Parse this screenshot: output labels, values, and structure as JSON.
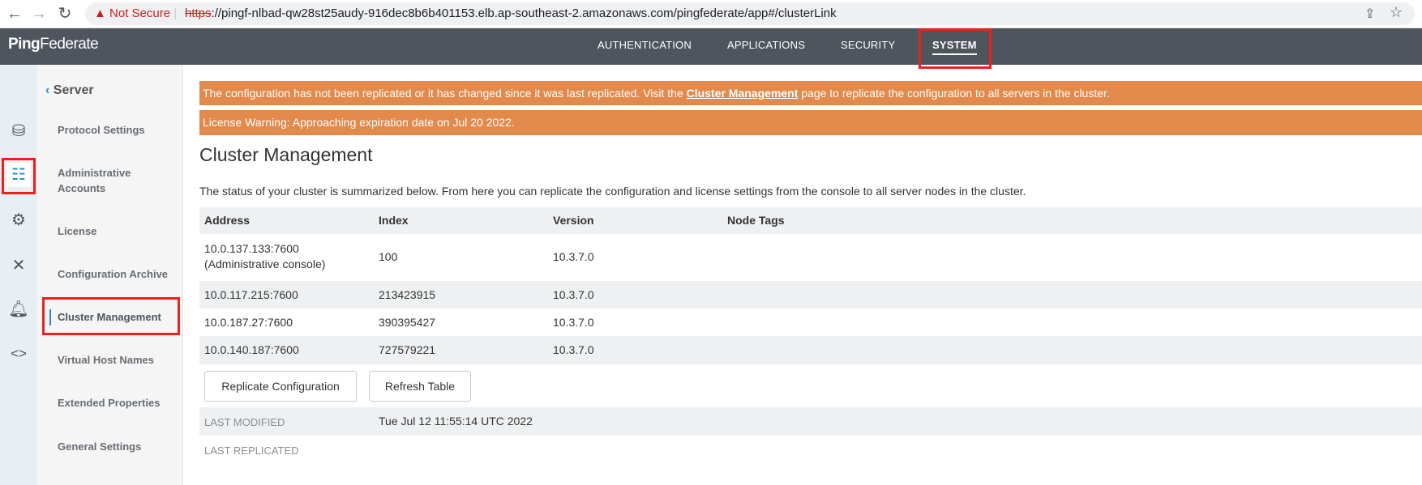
{
  "browser": {
    "not_secure": "Not Secure",
    "url_scheme": "https",
    "url_rest": "://pingf-nlbad-qw28st25audy-916dec8b6b401153.elb.ap-southeast-2.amazonaws.com/pingfederate/app#/clusterLink"
  },
  "header": {
    "logo_bold": "Ping",
    "logo_rest": "Federate",
    "tabs": [
      "AUTHENTICATION",
      "APPLICATIONS",
      "SECURITY",
      "SYSTEM"
    ],
    "active_tab": "SYSTEM"
  },
  "sidebar": {
    "back_label": "Server",
    "items": [
      "Protocol Settings",
      "Administrative Accounts",
      "License",
      "Configuration Archive",
      "Cluster Management",
      "Virtual Host Names",
      "Extended Properties",
      "General Settings"
    ],
    "active": "Cluster Management"
  },
  "banners": {
    "replication_pre": "The configuration has not been replicated or it has changed since it was last replicated. Visit the ",
    "replication_link": "Cluster Management",
    "replication_post": " page to replicate the configuration to all servers in the cluster.",
    "license": "License Warning: Approaching expiration date on Jul 20 2022."
  },
  "main": {
    "title": "Cluster Management",
    "description": "The status of your cluster is summarized below. From here you can replicate the configuration and license settings from the console to all server nodes in the cluster.",
    "columns": [
      "Address",
      "Index",
      "Version",
      "Node Tags"
    ],
    "rows": [
      {
        "address": "10.0.137.133:7600",
        "note": "(Administrative console)",
        "index": "100",
        "version": "10.3.7.0",
        "tags": ""
      },
      {
        "address": "10.0.117.215:7600",
        "index": "213423915",
        "version": "10.3.7.0",
        "tags": ""
      },
      {
        "address": "10.0.187.27:7600",
        "index": "390395427",
        "version": "10.3.7.0",
        "tags": ""
      },
      {
        "address": "10.0.140.187:7600",
        "index": "727579221",
        "version": "10.3.7.0",
        "tags": ""
      }
    ],
    "replicate_button": "Replicate Configuration",
    "refresh_button": "Refresh Table",
    "last_modified_label": "LAST MODIFIED",
    "last_modified_value": "Tue Jul 12 11:55:14 UTC 2022",
    "last_replicated_label": "LAST REPLICATED"
  },
  "colors": {
    "banner": "#e2894c",
    "topbar": "#4e555d",
    "accent": "#1f8fd1",
    "highlight": "#e8221b"
  }
}
